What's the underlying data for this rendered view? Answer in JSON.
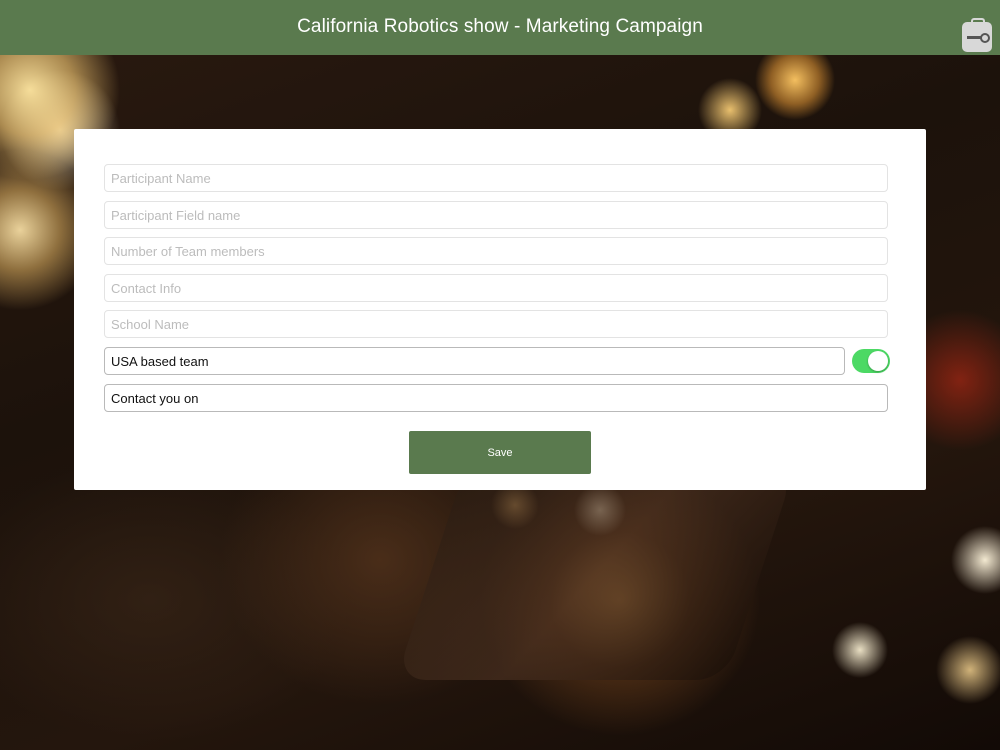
{
  "header": {
    "title": "California Robotics show - Marketing Campaign",
    "color": "#5a7a4e",
    "action_icon": "briefcase-key-icon"
  },
  "form": {
    "fields": [
      {
        "placeholder": "Participant Name",
        "value": ""
      },
      {
        "placeholder": "Participant Field name",
        "value": ""
      },
      {
        "placeholder": "Number of Team members",
        "value": ""
      },
      {
        "placeholder": "Contact Info",
        "value": ""
      },
      {
        "placeholder": "School Name",
        "value": ""
      }
    ],
    "usa_team": {
      "label": "USA based team",
      "toggle_on": true,
      "toggle_color": "#4cd964"
    },
    "contact_method": {
      "label": "Contact you on"
    },
    "save_label": "Save",
    "save_color": "#5a7a4e"
  }
}
